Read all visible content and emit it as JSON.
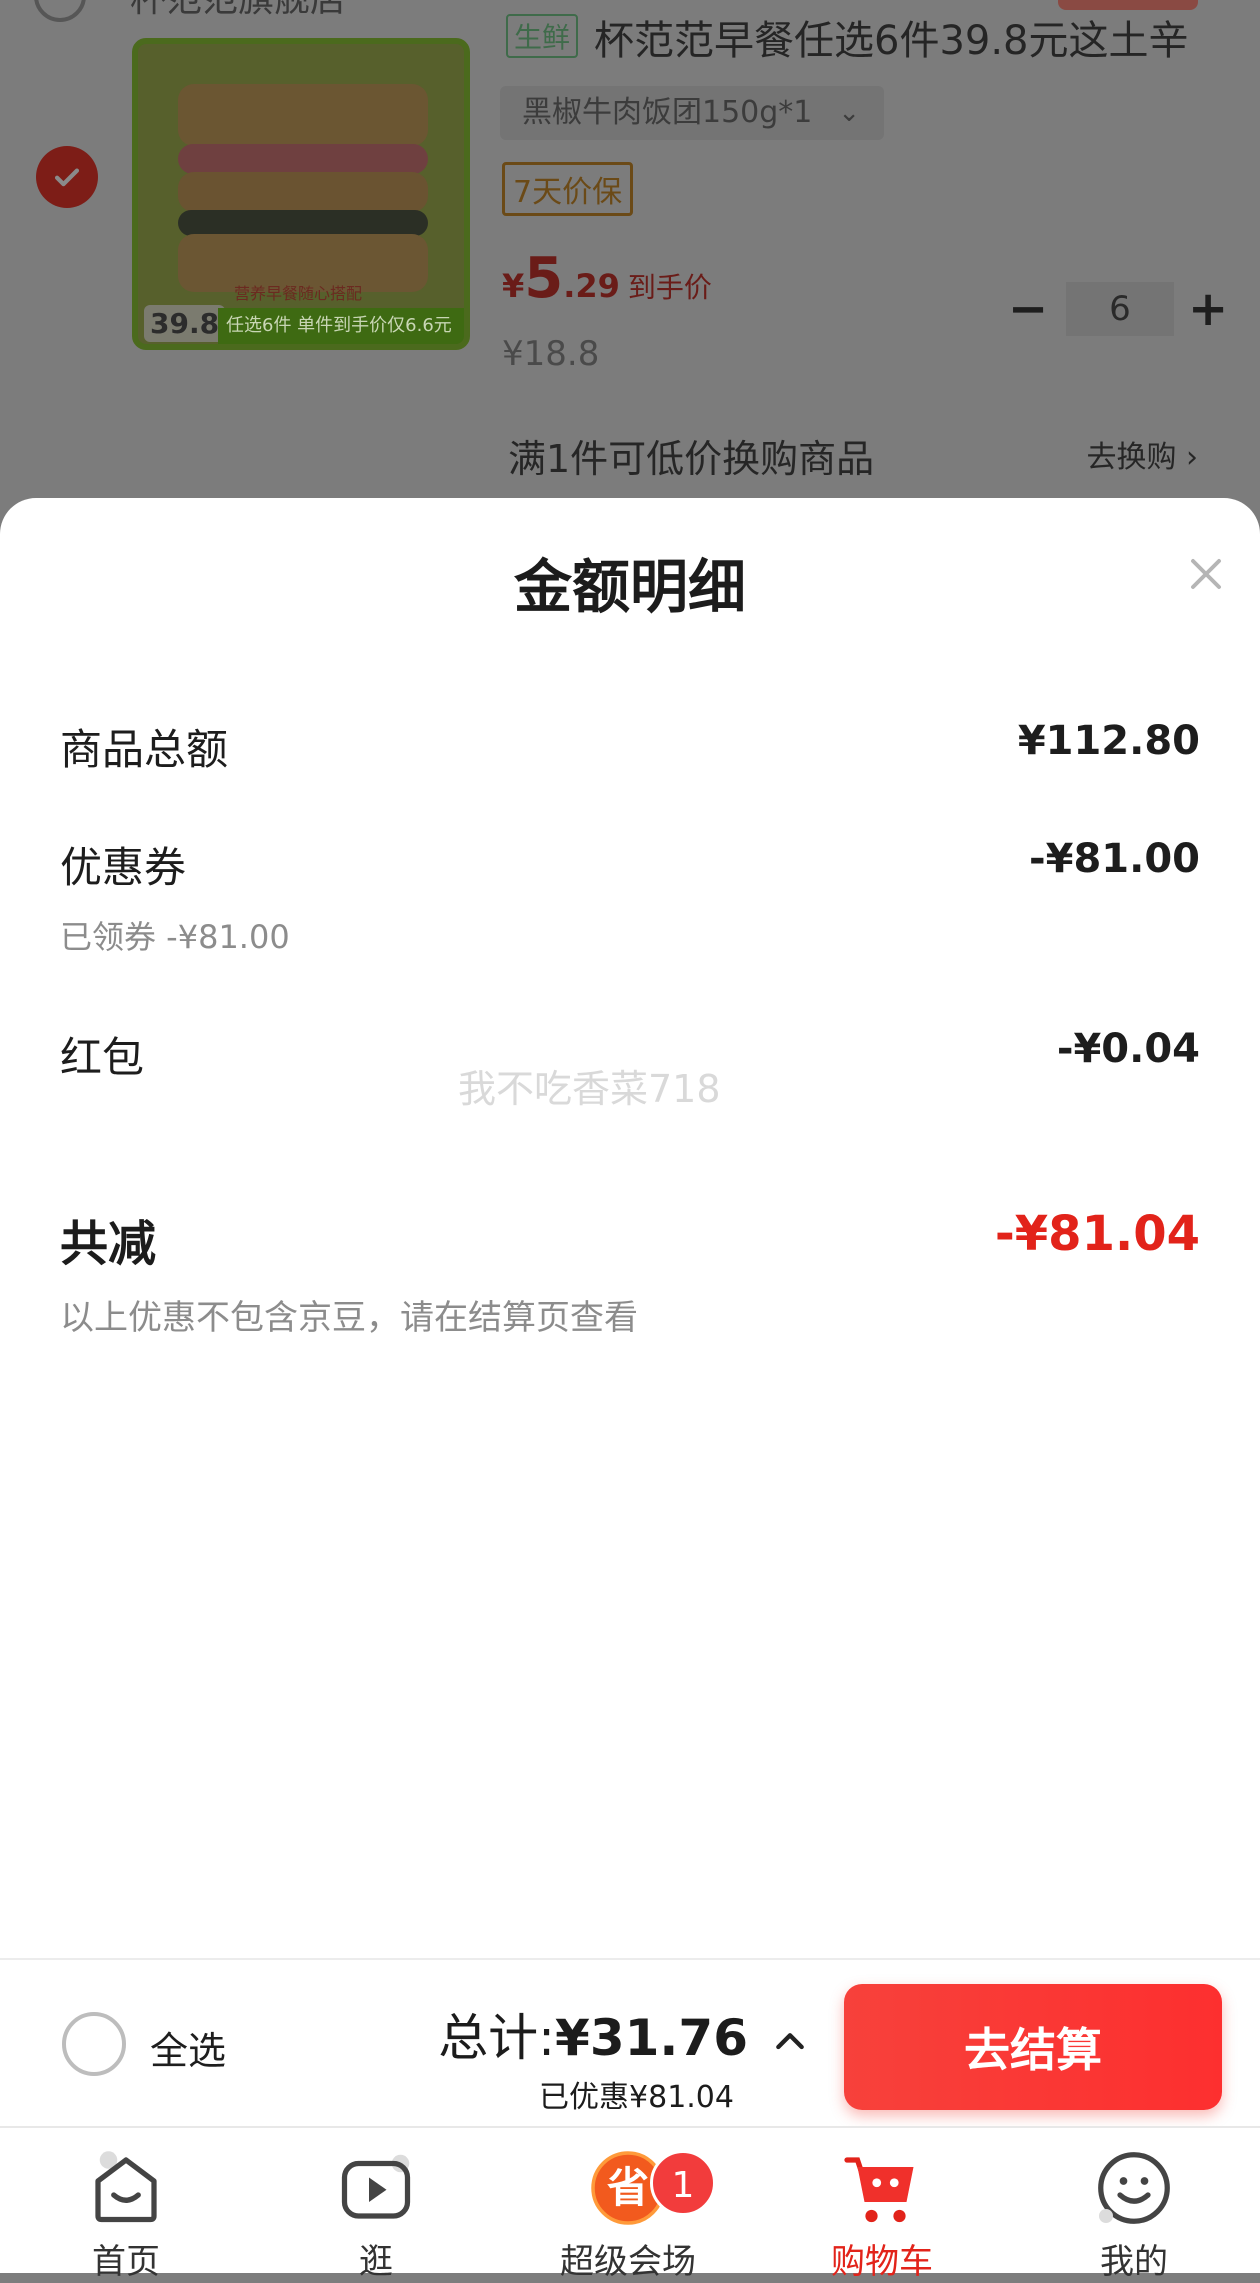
{
  "cart": {
    "shop_name": "杯范范旗舰店",
    "product_tag": "生鲜",
    "product_title": "杯范范早餐任选6件39.8元这土辛",
    "spec": "黑椒牛肉饭团150g*1",
    "guarantee_badge": "7天价保",
    "deal_currency": "¥",
    "deal_price_int": "5",
    "deal_price_dec": ".29",
    "deal_label": "到手价",
    "original_price": "¥18.8",
    "quantity": "6",
    "thumb_price": "39.8",
    "thumb_slogan": "营养早餐随心搭配",
    "thumb_bar": "任选6件  单件到手价仅6.6元",
    "exchange_text": "满1件可低价换购商品",
    "exchange_link": "去换购 ›"
  },
  "sheet": {
    "title": "金额明细",
    "rows": [
      {
        "label": "商品总额",
        "value": "¥112.80"
      },
      {
        "label": "优惠券",
        "value": "-¥81.00",
        "note": "已领券 -¥81.00"
      },
      {
        "label": "红包",
        "value": "-¥0.04"
      }
    ],
    "watermark": "我不吃香菜718",
    "total_label": "共减",
    "total_value": "-¥81.04",
    "total_note": "以上优惠不包含京豆，请在结算页查看"
  },
  "checkout": {
    "select_all": "全选",
    "total_prefix": "总计:",
    "total_amount": "¥31.76",
    "saved": "已优惠¥81.04",
    "button": "去结算"
  },
  "tabs": [
    {
      "label": "首页",
      "icon": "home-icon"
    },
    {
      "label": "逛",
      "icon": "video-play-icon"
    },
    {
      "label": "超级会场",
      "icon": "super-venue-icon",
      "badge": "1"
    },
    {
      "label": "购物车",
      "icon": "cart-icon",
      "active": true
    },
    {
      "label": "我的",
      "icon": "smiley-profile-icon"
    }
  ],
  "colors": {
    "accent": "#e2231a",
    "checkout_button": "#f7413b",
    "overlay": "#7c7c7c"
  }
}
